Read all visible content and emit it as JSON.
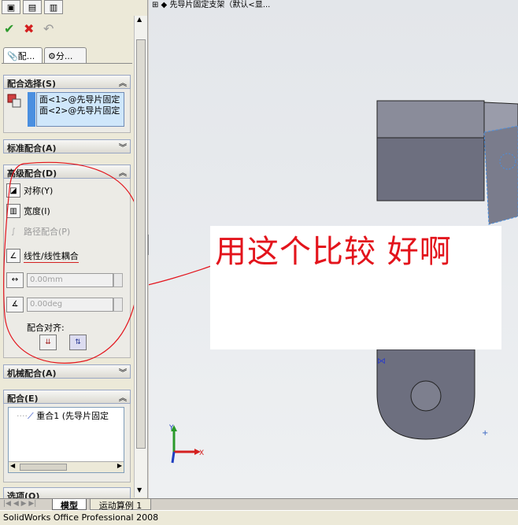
{
  "feature_tree_crumb": "先导片固定支架（默认<显...",
  "property_tabs": [
    "配...",
    "分..."
  ],
  "mate_selections": {
    "header": "配合选择(S)",
    "items": [
      "面<1>@先导片固定",
      "面<2>@先导片固定"
    ]
  },
  "standard_mates": {
    "header": "标准配合(A)"
  },
  "advanced_mates": {
    "header": "高级配合(D)",
    "items": [
      {
        "label": "对称(Y)",
        "enabled": true
      },
      {
        "label": "宽度(I)",
        "enabled": true
      },
      {
        "label": "路径配合(P)",
        "enabled": false
      },
      {
        "label": "线性/线性耦合",
        "enabled": true
      }
    ],
    "distance_value": "0.00mm",
    "angle_value": "0.00deg",
    "alignment_label": "配合对齐:"
  },
  "mechanical_mates": {
    "header": "机械配合(A)"
  },
  "mates": {
    "header": "配合(E)",
    "tree_item": "重合1 (先导片固定"
  },
  "options": {
    "header": "选项(O)"
  },
  "bottom_tabs": [
    "模型",
    "运动算例 1"
  ],
  "status_bar": "SolidWorks Office Professional 2008",
  "annotation_text": "用这个比较  好啊",
  "triad": {
    "x": "X",
    "y": "Y"
  },
  "colors": {
    "annotation_red": "#e3141c",
    "part_gray": "#6d6f7f",
    "selection_blue": "#4a8fe0"
  }
}
